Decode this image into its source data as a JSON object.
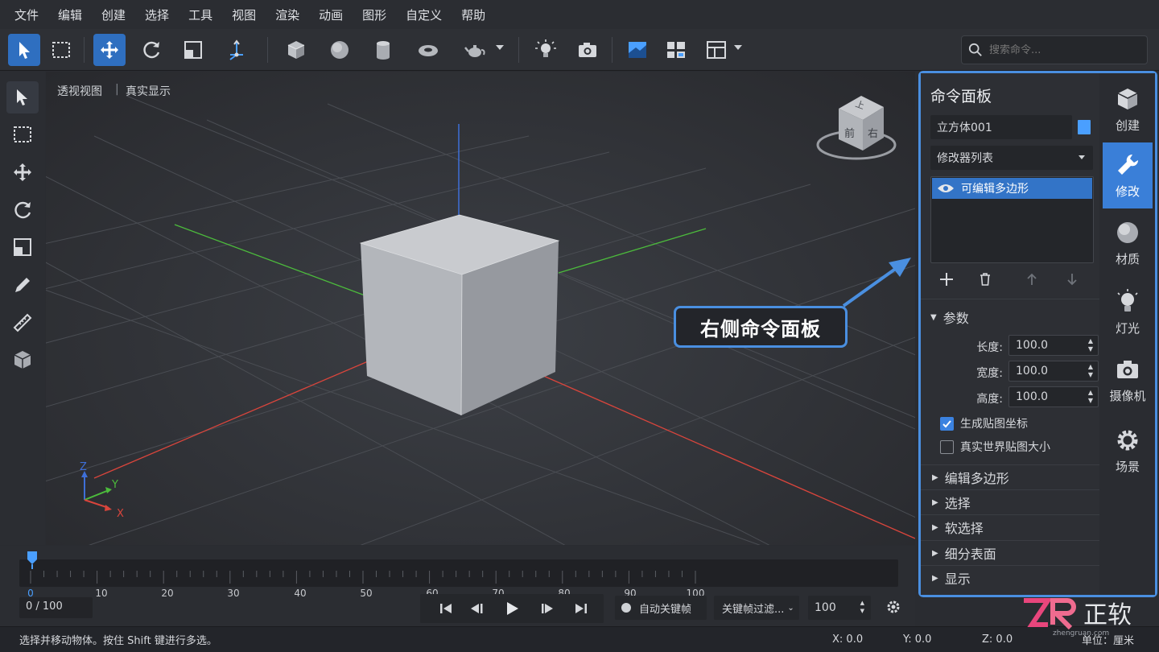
{
  "menu": [
    "文件",
    "编辑",
    "创建",
    "选择",
    "工具",
    "视图",
    "渲染",
    "动画",
    "图形",
    "自定义",
    "帮助"
  ],
  "search": {
    "placeholder": "搜索命令..."
  },
  "viewport": {
    "view_label": "透视视图",
    "separator": "|",
    "shade_label": "真实显示"
  },
  "viewcube": {
    "top": "上",
    "front": "前",
    "right": "右"
  },
  "axis": {
    "z": "Z",
    "y": "Y",
    "x": "X"
  },
  "callout": "右侧命令面板",
  "timeline": {
    "ticks": [
      "0",
      "10",
      "20",
      "30",
      "40",
      "50",
      "60",
      "70",
      "80",
      "90",
      "100"
    ],
    "frame_display": "0 / 100",
    "auto_key": "自动关键帧",
    "key_filter": "关键帧过滤...",
    "end_frame": "100"
  },
  "status": {
    "hint": "选择并移动物体。按住 Shift 键进行多选。",
    "x": "X: 0.0",
    "y": "Y: 0.0",
    "z": "Z: 0.0",
    "unit": "单位：厘米"
  },
  "panel": {
    "title": "命令面板",
    "object_name": "立方体001",
    "object_color": "#4a9fff",
    "modifier_list": "修改器列表",
    "stack_item": "可编辑多边形",
    "params_title": "参数",
    "length_label": "长度:",
    "length": "100.0",
    "width_label": "宽度:",
    "width": "100.0",
    "height_label": "高度:",
    "height": "100.0",
    "gen_uv": "生成贴图坐标",
    "real_world": "真实世界贴图大小",
    "rollouts": [
      "编辑多边形",
      "选择",
      "软选择",
      "细分表面",
      "显示"
    ]
  },
  "tabs": [
    "创建",
    "修改",
    "材质",
    "灯光",
    "摄像机",
    "场景"
  ],
  "brand": {
    "logo": "ZR 正软",
    "site": "zhengruan.com"
  },
  "colors": {
    "accent": "#3b82e0",
    "x_axis": "#d9453c",
    "y_axis": "#4cbb3c",
    "z_axis": "#3e6fd8"
  }
}
